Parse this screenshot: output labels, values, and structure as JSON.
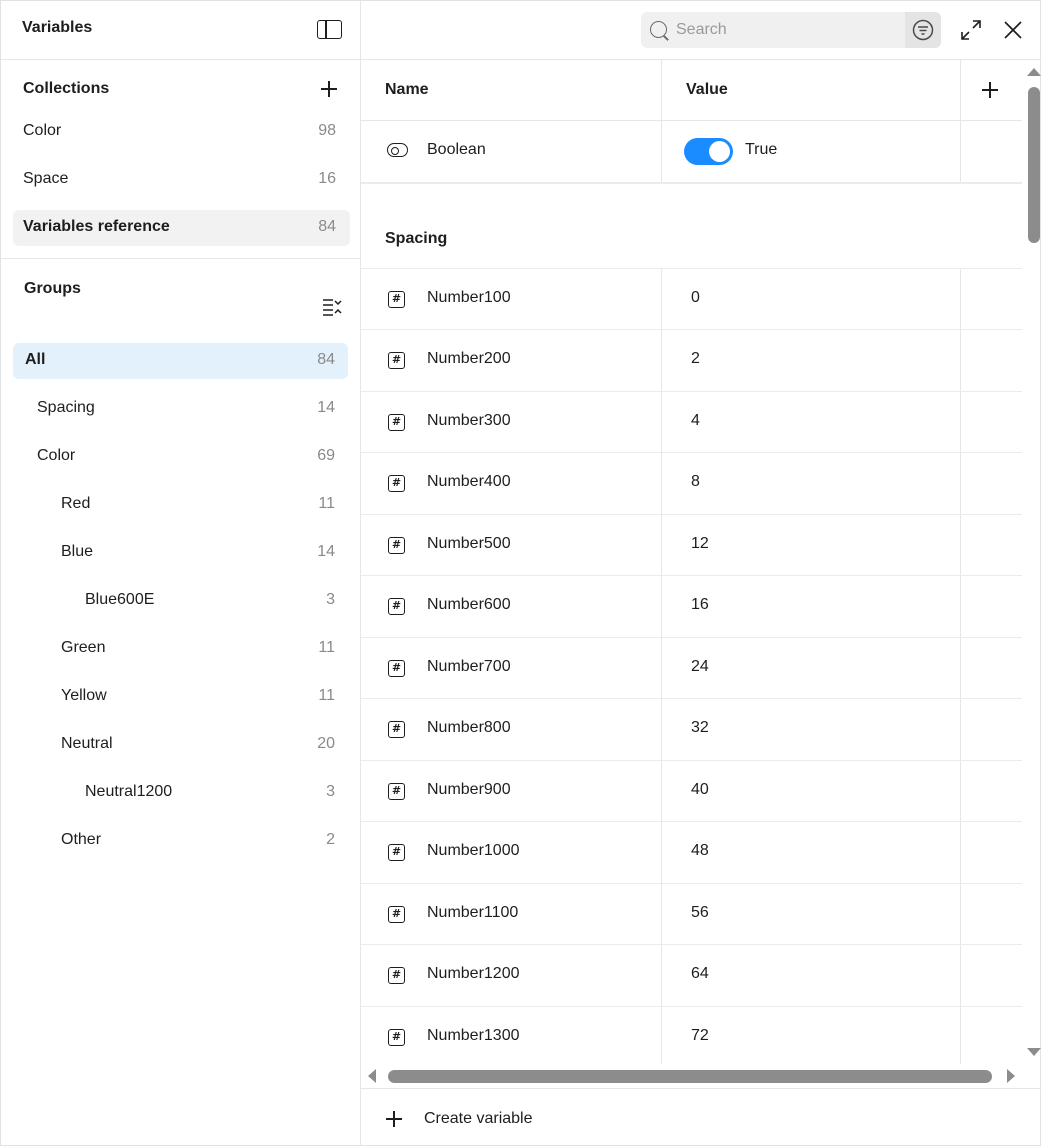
{
  "window": {
    "title": "Variables"
  },
  "collections": {
    "title": "Collections",
    "items": [
      {
        "label": "Color",
        "count": "98"
      },
      {
        "label": "Space",
        "count": "16"
      },
      {
        "label": "Variables reference",
        "count": "84"
      }
    ]
  },
  "groups": {
    "title": "Groups",
    "items": [
      {
        "label": "All",
        "count": "84"
      },
      {
        "label": "Spacing",
        "count": "14"
      },
      {
        "label": "Color",
        "count": "69"
      },
      {
        "label": "Red",
        "count": "11"
      },
      {
        "label": "Blue",
        "count": "14"
      },
      {
        "label": "Blue600E",
        "count": "3"
      },
      {
        "label": "Green",
        "count": "11"
      },
      {
        "label": "Yellow",
        "count": "11"
      },
      {
        "label": "Neutral",
        "count": "20"
      },
      {
        "label": "Neutral1200",
        "count": "3"
      },
      {
        "label": "Other",
        "count": "2"
      }
    ]
  },
  "search": {
    "placeholder": "Search"
  },
  "table": {
    "columns": {
      "name": "Name",
      "value": "Value"
    },
    "boolean_row": {
      "name": "Boolean",
      "value": "True"
    },
    "group_header": "Spacing",
    "rows": [
      {
        "name": "Number100",
        "value": "0"
      },
      {
        "name": "Number200",
        "value": "2"
      },
      {
        "name": "Number300",
        "value": "4"
      },
      {
        "name": "Number400",
        "value": "8"
      },
      {
        "name": "Number500",
        "value": "12"
      },
      {
        "name": "Number600",
        "value": "16"
      },
      {
        "name": "Number700",
        "value": "24"
      },
      {
        "name": "Number800",
        "value": "32"
      },
      {
        "name": "Number900",
        "value": "40"
      },
      {
        "name": "Number1000",
        "value": "48"
      },
      {
        "name": "Number1100",
        "value": "56"
      },
      {
        "name": "Number1200",
        "value": "64"
      },
      {
        "name": "Number1300",
        "value": "72"
      }
    ]
  },
  "footer": {
    "create_label": "Create variable"
  },
  "colors": {
    "accent": "#1a8cff",
    "selected_bg": "#e3f1fc"
  }
}
